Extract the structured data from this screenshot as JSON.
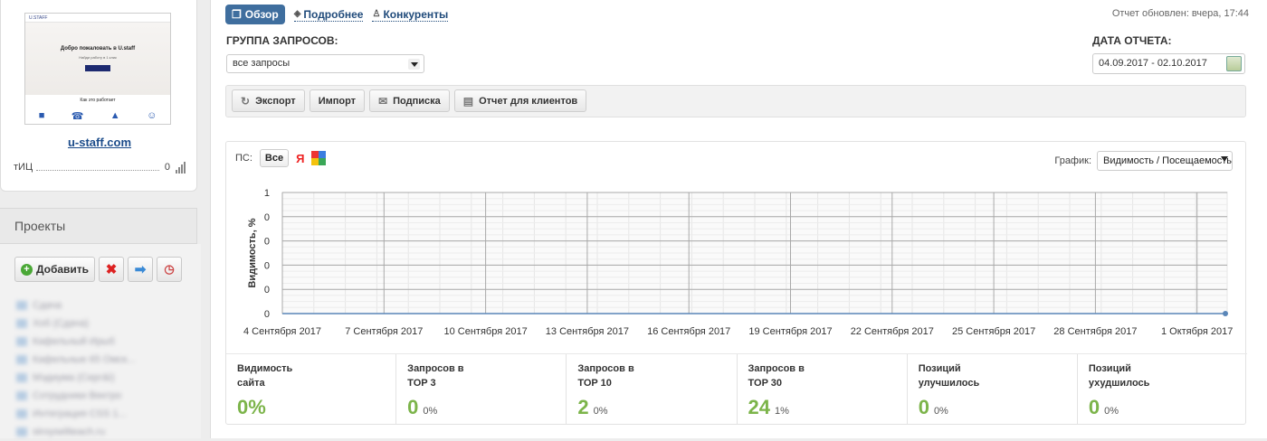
{
  "sidebar": {
    "thumbnail": {
      "brand": "U.STAFF",
      "headline": "Добро пожаловать в U.staff",
      "subline": "Найди работу в 1 клик",
      "how": "Как это работает"
    },
    "site_link": "u-staff.com",
    "tic_label": "тИЦ",
    "tic_value": "0",
    "projects_title": "Проекты",
    "add_label": "Добавить",
    "projects": [
      "Сдача",
      "Хоб (Сдача)",
      "Кафельный Ирыб",
      "Кафельные 65 Омск...",
      "Мэдиума (Серг&i)",
      "Сотрудники Вектро",
      "Интеграция CSS 1...",
      "stroyseliteach.ru"
    ]
  },
  "tabs": [
    {
      "label": "Обзор",
      "active": true
    },
    {
      "label": "Подробнее",
      "active": false
    },
    {
      "label": "Конкуренты",
      "active": false
    }
  ],
  "updated": "Отчет обновлен: вчера, 17:44",
  "query_group": {
    "label": "ГРУППА ЗАПРОСОВ:",
    "value": "все запросы"
  },
  "report_date": {
    "label": "ДАТА ОТЧЕТА:",
    "value": "04.09.2017 - 02.10.2017"
  },
  "actions": [
    "Экспорт",
    "Импорт",
    "Подписка",
    "Отчет для клиентов"
  ],
  "ps": {
    "label": "ПС:",
    "all": "Все",
    "yandex": "Я"
  },
  "graph": {
    "label": "График:",
    "value": "Видимость / Посещаемость"
  },
  "chart_data": {
    "type": "line",
    "ylabel": "Видимость, %",
    "y_ticks": [
      "1",
      "0",
      "0",
      "0",
      "0",
      "0"
    ],
    "x_ticks": [
      "4 Сентября 2017",
      "7 Сентября 2017",
      "10 Сентября 2017",
      "13 Сентября 2017",
      "16 Сентября 2017",
      "19 Сентября 2017",
      "22 Сентября 2017",
      "25 Сентября 2017",
      "28 Сентября 2017",
      "1 Октября 2017"
    ],
    "series": [
      {
        "values": [
          0,
          0,
          0,
          0,
          0,
          0,
          0,
          0,
          0,
          0
        ]
      }
    ],
    "ylim": [
      0,
      1
    ],
    "grid": true
  },
  "stats": [
    {
      "label1": "Видимость",
      "label2": "сайта",
      "value": "0%",
      "pct": ""
    },
    {
      "label1": "Запросов в",
      "label2": "TOP 3",
      "value": "0",
      "pct": "0%"
    },
    {
      "label1": "Запросов в",
      "label2": "TOP 10",
      "value": "2",
      "pct": "0%"
    },
    {
      "label1": "Запросов в",
      "label2": "TOP 30",
      "value": "24",
      "pct": "1%"
    },
    {
      "label1": "Позиций",
      "label2": "улучшилось",
      "value": "0",
      "pct": "0%"
    },
    {
      "label1": "Позиций",
      "label2": "ухудшилось",
      "value": "0",
      "pct": "0%"
    }
  ]
}
